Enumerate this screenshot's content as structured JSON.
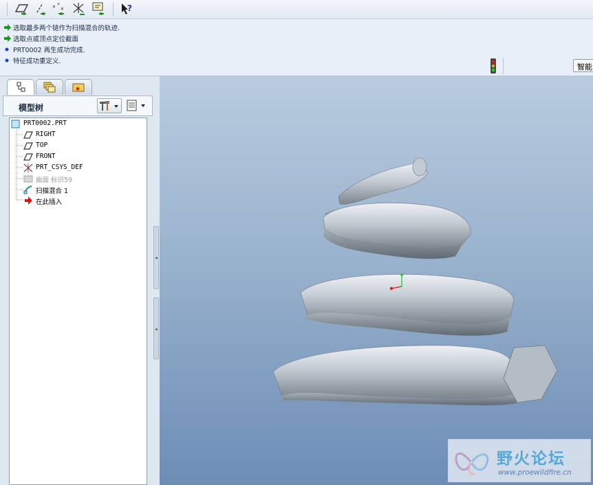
{
  "toolbar": {
    "buttons": [
      {
        "name": "datum-plane-toggle",
        "icon": "datum-plane-icon"
      },
      {
        "name": "datum-axis-toggle",
        "icon": "datum-axis-icon"
      },
      {
        "name": "datum-point-toggle",
        "icon": "datum-point-icon"
      },
      {
        "name": "csys-toggle",
        "icon": "coordinate-system-icon"
      },
      {
        "name": "annotation-toggle",
        "icon": "annotation-icon"
      },
      {
        "name": "context-help",
        "icon": "context-help-icon"
      }
    ]
  },
  "messages": [
    {
      "type": "prompt",
      "text": "选取最多两个链作为扫描混合的轨迹."
    },
    {
      "type": "prompt",
      "text": "选取点或顶点定位截面"
    },
    {
      "type": "info",
      "text": "PRT0002 再生成功完成."
    },
    {
      "type": "info",
      "text": "特征成功重定义."
    }
  ],
  "smart_filter": {
    "label": "智能"
  },
  "panel_tabs": [
    {
      "name": "model-tree-tab",
      "icon": "model-tree-icon",
      "active": true
    },
    {
      "name": "folder-browser-tab",
      "icon": "folder-icon",
      "active": false
    },
    {
      "name": "favorites-tab",
      "icon": "favorites-icon",
      "active": false
    }
  ],
  "model_tree": {
    "title": "模型树",
    "settings_icon": "tree-settings-icon",
    "columns_icon": "tree-columns-icon",
    "items": [
      {
        "label": "PRT0002.PRT",
        "icon": "part-icon",
        "dim": false
      },
      {
        "label": "RIGHT",
        "icon": "datum-plane-icon",
        "dim": false
      },
      {
        "label": "TOP",
        "icon": "datum-plane-icon",
        "dim": false
      },
      {
        "label": "FRONT",
        "icon": "datum-plane-icon",
        "dim": false
      },
      {
        "label": "PRT_CSYS_DEF",
        "icon": "coordinate-system-icon",
        "dim": false
      },
      {
        "label": "曲面 标识59",
        "icon": "surface-icon",
        "dim": true
      },
      {
        "label": "扫描混合 1",
        "icon": "swept-blend-icon",
        "dim": false
      },
      {
        "label": "在此插入",
        "icon": "insert-here-arrow-icon",
        "dim": false
      }
    ]
  },
  "watermark": {
    "title": "野火论坛",
    "url": "www.proewildfire.cn"
  },
  "colors": {
    "viewport_top": "#b9ccdf",
    "viewport_bottom": "#6d8db6",
    "prompt_arrow": "#1a9a1a",
    "info_bullet": "#1f3fc0",
    "insert_arrow": "#d01818"
  }
}
